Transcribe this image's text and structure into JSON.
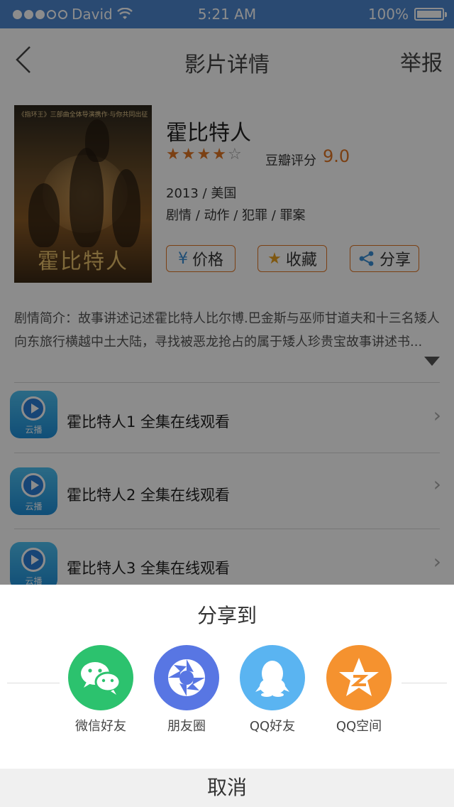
{
  "status_bar": {
    "carrier": "David",
    "time": "5:21 AM",
    "battery": "100%"
  },
  "nav": {
    "title": "影片详情",
    "report": "举报"
  },
  "poster": {
    "caption": "《指环王》三部曲全体导演携作·与你共同出征",
    "title": "霍比特人"
  },
  "movie": {
    "title": "霍比特人",
    "rating_stars": 4,
    "rating_max": 5,
    "douban_label": "豆瓣评分",
    "douban_score": "9.0",
    "year_country": "2013 / 美国",
    "genres": "剧情 / 动作 / 犯罪 / 罪案"
  },
  "actions": {
    "price": "价格",
    "favorite": "收藏",
    "share": "分享"
  },
  "synopsis": "剧情简介：故事讲述记述霍比特人比尔博.巴金斯与巫师甘道夫和十三名矮人向东旅行横越中土大陆，寻找被恶龙抢占的属于矮人珍贵宝故事讲述书...",
  "episodes": [
    {
      "icon_label": "云播",
      "text": "霍比特人1  全集在线观看"
    },
    {
      "icon_label": "云播",
      "text": "霍比特人2  全集在线观看"
    },
    {
      "icon_label": "云播",
      "text": "霍比特人3  全集在线观看"
    }
  ],
  "share_sheet": {
    "title": "分享到",
    "items": [
      {
        "label": "微信好友",
        "icon": "wechat-icon",
        "color": "#2cc26e"
      },
      {
        "label": "朋友圈",
        "icon": "moments-icon",
        "color": "#5876e3"
      },
      {
        "label": "QQ好友",
        "icon": "qq-icon",
        "color": "#5ab4f1"
      },
      {
        "label": "QQ空间",
        "icon": "qzone-icon",
        "color": "#f5922f"
      }
    ],
    "cancel": "取消"
  }
}
